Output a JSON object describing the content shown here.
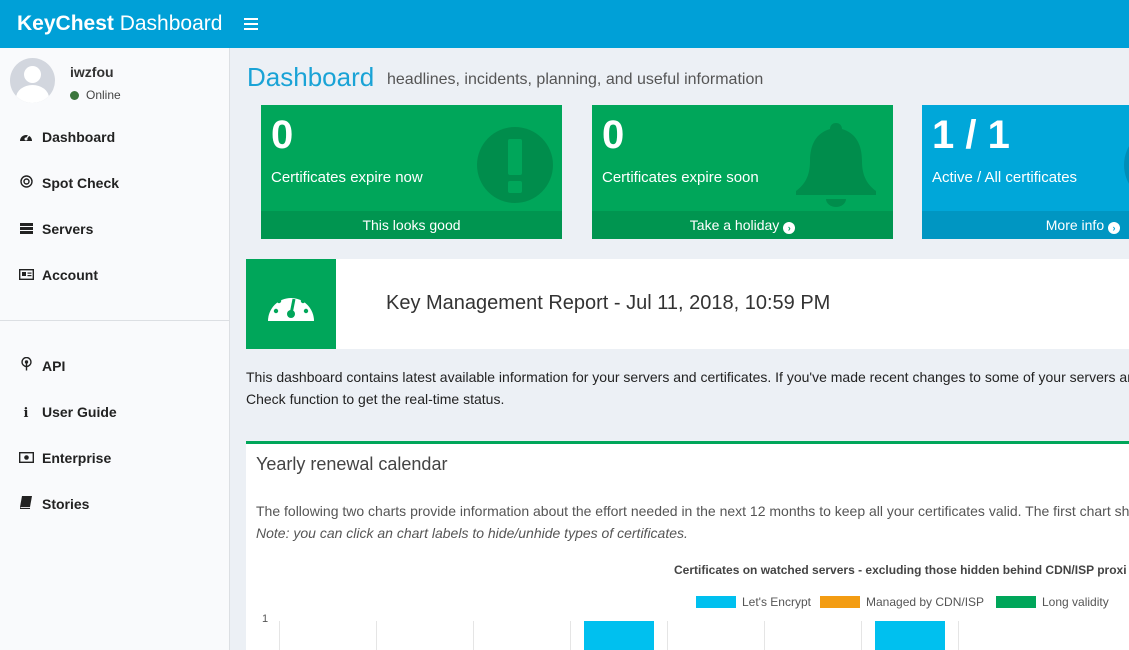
{
  "app": {
    "logo_bold": "KeyChest",
    "logo_rest": " Dashboard",
    "menu_icon": "hamburger-icon"
  },
  "user": {
    "name": "iwzfou",
    "status": "Online",
    "status_color": "#3c763d"
  },
  "nav": {
    "primary": [
      {
        "label": "Dashboard",
        "icon": "speedometer-icon"
      },
      {
        "label": "Spot Check",
        "icon": "target-icon"
      },
      {
        "label": "Servers",
        "icon": "server-icon"
      },
      {
        "label": "Account",
        "icon": "id-card-icon"
      }
    ],
    "secondary": [
      {
        "label": "API",
        "icon": "broadcast-icon"
      },
      {
        "label": "User Guide",
        "icon": "info-icon"
      },
      {
        "label": "Enterprise",
        "icon": "money-icon"
      },
      {
        "label": "Stories",
        "icon": "book-icon"
      }
    ]
  },
  "header": {
    "title": "Dashboard",
    "subtitle": "headlines, incidents, planning, and useful information"
  },
  "stats": [
    {
      "value": "0",
      "label": "Certificates expire now",
      "footer": "This looks good",
      "color": "#00a65a",
      "icon": "exclamation-circle-icon"
    },
    {
      "value": "0",
      "label": "Certificates expire soon",
      "footer": "Take a holiday",
      "color": "#00a65a",
      "icon": "bell-icon"
    },
    {
      "value": "1 / 1",
      "label": "Active / All certificates",
      "footer": "More info",
      "color": "#00a7d9",
      "icon": "circle-icon"
    }
  ],
  "report": {
    "title": "Key Management Report - Jul 11, 2018, 10:59 PM",
    "icon": "dashboard-gauge-icon"
  },
  "intro": {
    "line1": "This dashboard contains latest available information for your servers and certificates. If you've made recent changes to some of your servers an",
    "line2": "Check function to get the real-time status."
  },
  "renewal": {
    "title": "Yearly renewal calendar",
    "desc": "The following two charts provide information about the effort needed in the next 12 months to keep all your certificates valid. The first chart sh",
    "note": "Note: you can click an chart labels to hide/unhide types of certificates."
  },
  "chart_data": {
    "type": "bar",
    "title": "Certificates on watched servers - excluding those hidden behind CDN/ISP proxi",
    "legend_position": "top-right",
    "series": [
      {
        "name": "Let's Encrypt",
        "color": "#00c0ef"
      },
      {
        "name": "Managed by CDN/ISP",
        "color": "#f39c12"
      },
      {
        "name": "Long validity",
        "color": "#00a65a"
      }
    ],
    "y_tick_visible": "1",
    "visible_bars": [
      {
        "series": "Let's Encrypt",
        "slot": 4,
        "value": 1
      },
      {
        "series": "Let's Encrypt",
        "slot": 7,
        "value": 1
      }
    ]
  }
}
